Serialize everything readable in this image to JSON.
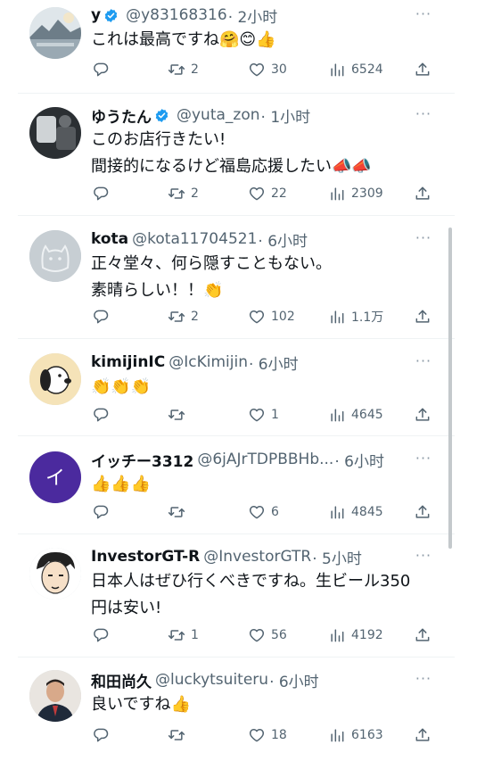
{
  "tweets": [
    {
      "name": "y",
      "verified": true,
      "handle": "@y83168316",
      "time": "· 2小时",
      "lines": [
        "これは最高ですね🤗😊👍"
      ],
      "reply": "",
      "retweets": "2",
      "likes": "30",
      "views": "6524",
      "avatar": "landscape-photo",
      "avatar_letter": ""
    },
    {
      "name": "ゆうたん",
      "verified": true,
      "handle": "@yuta_zon",
      "time": "· 1小时",
      "lines": [
        "このお店行きたい!",
        "間接的になるけど福島応援したい📣📣"
      ],
      "reply": "",
      "retweets": "2",
      "likes": "22",
      "views": "2309",
      "avatar": "dark-photo",
      "avatar_letter": ""
    },
    {
      "name": "kota",
      "verified": false,
      "handle": "@kota11704521",
      "time": "· 6小时",
      "lines": [
        "正々堂々、何ら隠すこともない。",
        "素晴らしい！！👏"
      ],
      "reply": "",
      "retweets": "2",
      "likes": "102",
      "views": "1.1万",
      "avatar": "cat-sketch",
      "avatar_letter": ""
    },
    {
      "name": "kimijinIC",
      "verified": false,
      "handle": "@IcKimijin",
      "time": "· 6小时",
      "lines": [
        "👏👏👏"
      ],
      "reply": "",
      "retweets": "",
      "likes": "1",
      "views": "4645",
      "avatar": "snoopy",
      "avatar_letter": ""
    },
    {
      "name": "イッチー3312",
      "verified": false,
      "handle": "@6jAJrTDPBBHb...",
      "time": "· 6小时",
      "lines": [
        "👍👍👍"
      ],
      "reply": "",
      "retweets": "",
      "likes": "6",
      "views": "4845",
      "avatar": "letter",
      "avatar_letter": "イ"
    },
    {
      "name": "InvestorGT-R",
      "verified": false,
      "handle": "@InvestorGTR",
      "time": "· 5小时",
      "lines": [
        "日本人はぜひ行くべきですね。生ビール350",
        "円は安い!"
      ],
      "reply": "",
      "retweets": "1",
      "likes": "56",
      "views": "4192",
      "avatar": "manga-face",
      "avatar_letter": ""
    },
    {
      "name": "和田尚久",
      "verified": false,
      "handle": "@luckytsuiteru",
      "time": "· 6小时",
      "lines": [
        "良いですね👍"
      ],
      "reply": "",
      "retweets": "",
      "likes": "18",
      "views": "6163",
      "avatar": "portrait-photo",
      "avatar_letter": ""
    }
  ],
  "icons": {
    "reply": "reply-icon",
    "retweet": "retweet-icon",
    "like": "heart-icon",
    "views": "views-icon",
    "share": "share-icon",
    "more": "more-icon",
    "verified": "verified-icon"
  },
  "colors": {
    "verified": "#1d9bf0",
    "secondary_text": "#536471",
    "purple_avatar": "#4b2a9e"
  }
}
